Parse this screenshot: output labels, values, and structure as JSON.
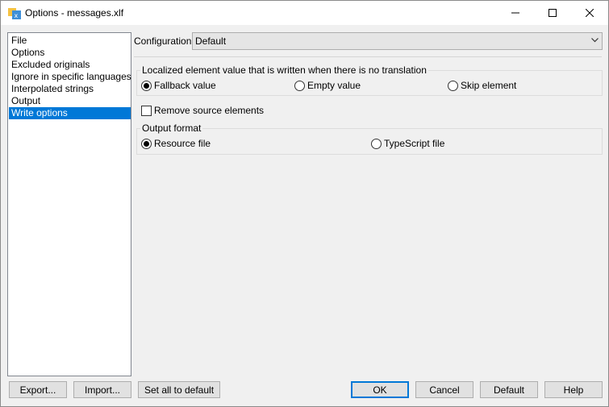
{
  "window": {
    "title": "Options - messages.xlf"
  },
  "tree": {
    "items": [
      {
        "label": "File",
        "selected": false
      },
      {
        "label": "Options",
        "selected": false
      },
      {
        "label": "Excluded originals",
        "selected": false
      },
      {
        "label": "Ignore in specific languages",
        "selected": false
      },
      {
        "label": "Interpolated strings",
        "selected": false
      },
      {
        "label": "Output",
        "selected": false
      },
      {
        "label": "Write options",
        "selected": true
      }
    ]
  },
  "configuration": {
    "label": "Configuration:",
    "value": "Default"
  },
  "no_translation_group": {
    "title": "Localized element value that is written when there is no translation",
    "options": [
      {
        "label": "Fallback value",
        "checked": true
      },
      {
        "label": "Empty value",
        "checked": false
      },
      {
        "label": "Skip element",
        "checked": false
      }
    ]
  },
  "remove_source": {
    "label": "Remove source elements",
    "checked": false
  },
  "output_format_group": {
    "title": "Output format",
    "options": [
      {
        "label": "Resource file",
        "checked": true
      },
      {
        "label": "TypeScript file",
        "checked": false
      }
    ]
  },
  "buttons": {
    "export": "Export...",
    "import": "Import...",
    "set_default": "Set all to default",
    "ok": "OK",
    "cancel": "Cancel",
    "default": "Default",
    "help": "Help"
  }
}
